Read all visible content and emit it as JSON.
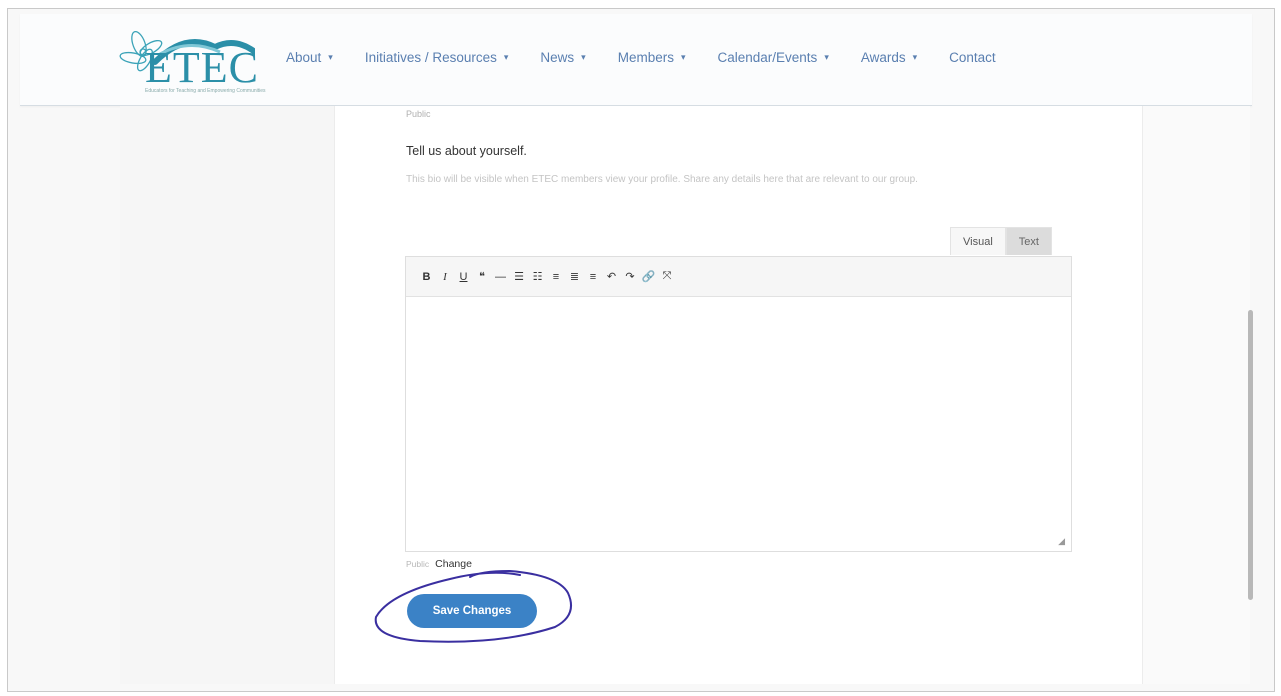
{
  "header": {
    "logo_text": "ETEC",
    "logo_subtext": "Educators for Teaching and Empowering Communities",
    "nav": [
      {
        "label": "About",
        "caret": "▾"
      },
      {
        "label": "Initiatives / Resources",
        "caret": "▾"
      },
      {
        "label": "News",
        "caret": "▾"
      },
      {
        "label": "Members",
        "caret": "▾"
      },
      {
        "label": "Calendar/Events",
        "caret": "▾"
      },
      {
        "label": "Awards",
        "caret": "▾"
      },
      {
        "label": "Contact",
        "caret": ""
      }
    ]
  },
  "form": {
    "previous_field_privacy": "Public",
    "bio_title": "Tell us about yourself.",
    "bio_description": "This bio will be visible when ETEC members view your profile. Share any details here that are relevant to our group.",
    "editor_tabs": [
      {
        "label": "Visual",
        "active": false
      },
      {
        "label": "Text",
        "active": true
      }
    ],
    "toolbar": [
      {
        "name": "bold-icon",
        "glyph": "B"
      },
      {
        "name": "italic-icon",
        "glyph": "I"
      },
      {
        "name": "underline-icon",
        "glyph": "U"
      },
      {
        "name": "blockquote-icon",
        "glyph": "❝"
      },
      {
        "name": "horizontal-rule-icon",
        "glyph": "―"
      },
      {
        "name": "bulleted-list-icon",
        "glyph": "☰"
      },
      {
        "name": "numbered-list-icon",
        "glyph": "☷"
      },
      {
        "name": "align-left-icon",
        "glyph": "≡"
      },
      {
        "name": "align-center-icon",
        "glyph": "≣"
      },
      {
        "name": "align-right-icon",
        "glyph": "≡"
      },
      {
        "name": "undo-icon",
        "glyph": "↶"
      },
      {
        "name": "redo-icon",
        "glyph": "↷"
      },
      {
        "name": "link-icon",
        "glyph": "🔗"
      },
      {
        "name": "fullscreen-icon",
        "glyph": "⤧"
      }
    ],
    "editor_value": "",
    "privacy_label": "Public",
    "change_label": "Change",
    "save_label": "Save Changes"
  },
  "colors": {
    "accent": "#3b82c6",
    "nav_text": "#5a7fb0",
    "logo": "#2b8fa8",
    "annotation": "#3a2fa0"
  }
}
